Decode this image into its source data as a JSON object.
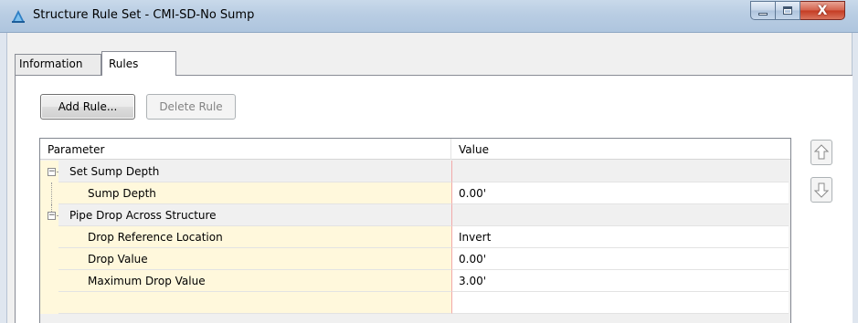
{
  "window": {
    "title": "Structure Rule Set - CMI-SD-No Sump",
    "controls": {
      "minimize": "minimize",
      "maximize": "maximize",
      "close": "X"
    }
  },
  "tabs": [
    {
      "label": "Information",
      "active": false
    },
    {
      "label": "Rules",
      "active": true
    }
  ],
  "toolbar": {
    "add_rule_label": "Add Rule...",
    "delete_rule_label": "Delete Rule"
  },
  "grid": {
    "columns": [
      "Parameter",
      "Value"
    ],
    "rows": [
      {
        "type": "group",
        "parameter": "Set Sump Depth",
        "value": ""
      },
      {
        "type": "child",
        "parameter": "Sump Depth",
        "value": "0.00'"
      },
      {
        "type": "group",
        "parameter": "Pipe Drop Across Structure",
        "value": ""
      },
      {
        "type": "child",
        "parameter": "Drop Reference Location",
        "value": "Invert"
      },
      {
        "type": "child",
        "parameter": "Drop Value",
        "value": "0.00'"
      },
      {
        "type": "child",
        "parameter": "Maximum Drop Value",
        "value": "3.00'"
      }
    ]
  },
  "icons": {
    "app": "civil3d-triangle-icon",
    "move_up": "arrow-up-icon",
    "move_down": "arrow-down-icon"
  },
  "colors": {
    "titlebar": "#b9cde3",
    "indent_band": "#fff8dc",
    "value_separator": "#f2a9a9",
    "close_button": "#c43b22"
  }
}
